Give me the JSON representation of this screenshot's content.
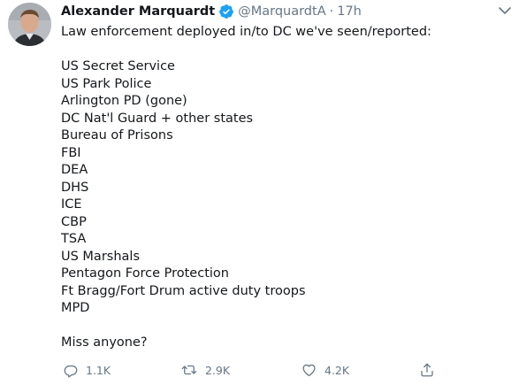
{
  "tweet": {
    "author_name": "Alexander Marquardt",
    "handle": "@MarquardtA",
    "separator": "·",
    "time": "17h",
    "text_intro": "Law enforcement deployed in/to DC we've seen/reported:",
    "list": [
      "US Secret Service",
      "US Park Police",
      "Arlington PD (gone)",
      "DC Nat'l Guard + other states",
      "Bureau of Prisons",
      "FBI",
      "DEA",
      "DHS",
      "ICE",
      "CBP",
      "TSA",
      "US Marshals",
      "Pentagon Force Protection",
      "Ft Bragg/Fort Drum active duty troops",
      "MPD"
    ],
    "text_outro": "Miss anyone?",
    "replies": "1.1K",
    "retweets": "2.9K",
    "likes": "4.2K"
  },
  "colors": {
    "text": "#14171a",
    "muted": "#657786",
    "verified": "#1da1f2"
  },
  "icons": {
    "reply": "reply-icon",
    "retweet": "retweet-icon",
    "like": "like-icon",
    "share": "share-icon",
    "verified": "verified-badge-icon",
    "menu": "chevron-down-icon"
  }
}
